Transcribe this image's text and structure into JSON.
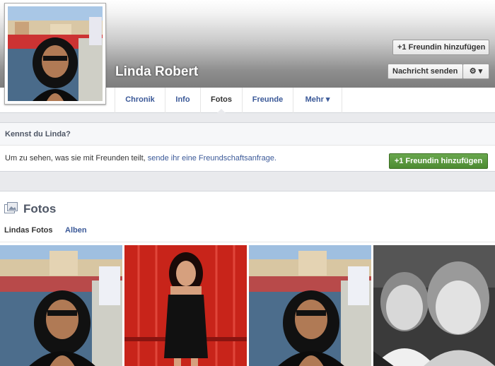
{
  "profile": {
    "name": "Linda Robert"
  },
  "actions": {
    "add_friend_top": "+1 Freundin hinzufügen",
    "message": "Nachricht senden",
    "gear": "⚙ ▾"
  },
  "nav": {
    "tabs": [
      "Chronik",
      "Info",
      "Fotos",
      "Freunde",
      "Mehr ▾"
    ]
  },
  "know": {
    "title": "Kennst du Linda?",
    "text": "Um zu sehen, was sie mit Freunden teilt,",
    "link": "sende ihr eine Freundschaftsanfrage.",
    "button": "+1 Freundin hinzufügen"
  },
  "photos": {
    "title": "Fotos",
    "subtabs": [
      "Lindas Fotos",
      "Alben"
    ]
  },
  "colors": {
    "link": "#3b5998",
    "green": "#4d8b32"
  }
}
